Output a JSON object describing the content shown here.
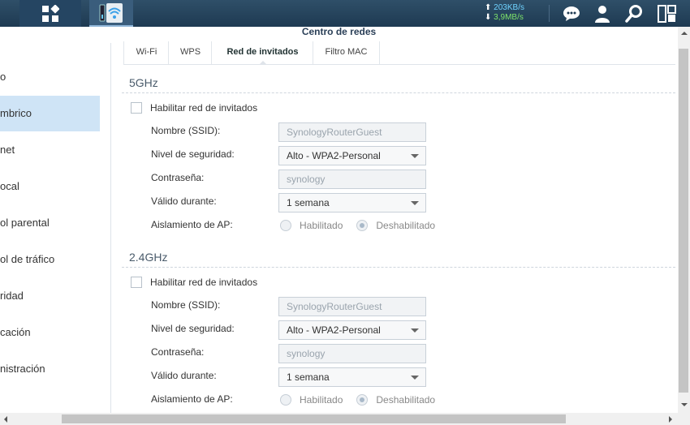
{
  "taskbar": {
    "upload_rate": "203KB/s",
    "download_rate": "3,9MB/s",
    "icons": [
      "main-menu-icon",
      "wifi-app-icon",
      "chat-icon",
      "user-icon",
      "search-icon",
      "widgets-icon"
    ]
  },
  "window": {
    "title": "Centro de redes"
  },
  "sidebar": {
    "items": [
      {
        "label": "o"
      },
      {
        "label": "mbrico"
      },
      {
        "label": "net"
      },
      {
        "label": "ocal"
      },
      {
        "label": "ol parental"
      },
      {
        "label": "ol de tráfico"
      },
      {
        "label": "ridad"
      },
      {
        "label": "cación"
      },
      {
        "label": "nistración"
      }
    ],
    "active_index": 1
  },
  "tabs": [
    {
      "label": "Wi-Fi"
    },
    {
      "label": "WPS"
    },
    {
      "label": "Red de invitados"
    },
    {
      "label": "Filtro MAC"
    }
  ],
  "active_tab": "Red de invitados",
  "sections": [
    {
      "title": "5GHz",
      "enable_label": "Habilitar red de invitados",
      "ssid_label": "Nombre (SSID):",
      "ssid_value": "SynologyRouterGuest",
      "security_label": "Nivel de seguridad:",
      "security_value": "Alto - WPA2-Personal",
      "password_label": "Contraseña:",
      "password_value": "synology",
      "valid_label": "Válido durante:",
      "valid_value": "1 semana",
      "isolation_label": "Aislamiento de AP:",
      "isolation_on": "Habilitado",
      "isolation_off": "Deshabilitado"
    },
    {
      "title": "2.4GHz",
      "enable_label": "Habilitar red de invitados",
      "ssid_label": "Nombre (SSID):",
      "ssid_value": "SynologyRouterGuest",
      "security_label": "Nivel de seguridad:",
      "security_value": "Alto - WPA2-Personal",
      "password_label": "Contraseña:",
      "password_value": "synology",
      "valid_label": "Válido durante:",
      "valid_value": "1 semana",
      "isolation_label": "Aislamiento de AP:",
      "isolation_on": "Habilitado",
      "isolation_off": "Deshabilitado"
    }
  ],
  "colors": {
    "taskbar": "#1e3a52",
    "active_sidebar": "#cfe4f6",
    "upload": "#6fd3ff",
    "download": "#7ee36a"
  }
}
